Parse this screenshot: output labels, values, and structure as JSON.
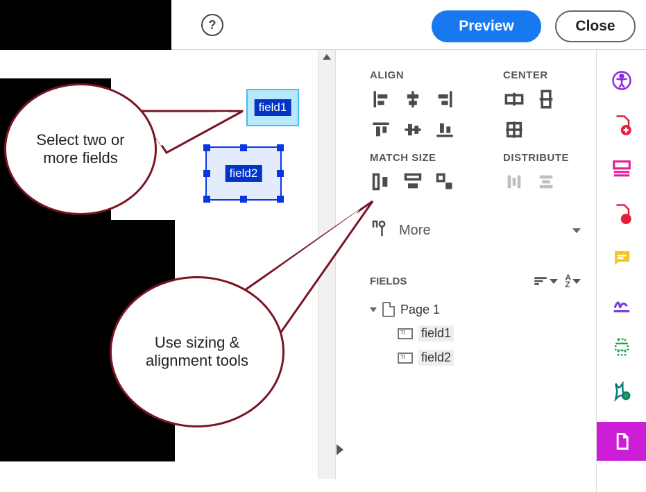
{
  "topbar": {
    "help_label": "?",
    "preview_label": "Preview",
    "close_label": "Close"
  },
  "fields_on_canvas": {
    "f1": "field1",
    "f2": "field2"
  },
  "panel": {
    "sections": {
      "align_hdr": "ALIGN",
      "center_hdr": "CENTER",
      "match_size_hdr": "MATCH SIZE",
      "distribute_hdr": "DISTRIBUTE"
    },
    "more_label": "More",
    "fields_hdr": "FIELDS",
    "sort_az": "A\nZ",
    "tree": {
      "page_label": "Page 1",
      "items": [
        "field1",
        "field2"
      ]
    }
  },
  "callouts": {
    "select_text": "Select two or more fields",
    "sizing_text": "Use sizing & alignment tools"
  },
  "colors": {
    "primary_blue": "#1778ef",
    "selection_blue": "#0a36e0",
    "field_fill": "#b9e8fb",
    "maroon": "#7a1423",
    "magenta": "#cc1ed6"
  }
}
